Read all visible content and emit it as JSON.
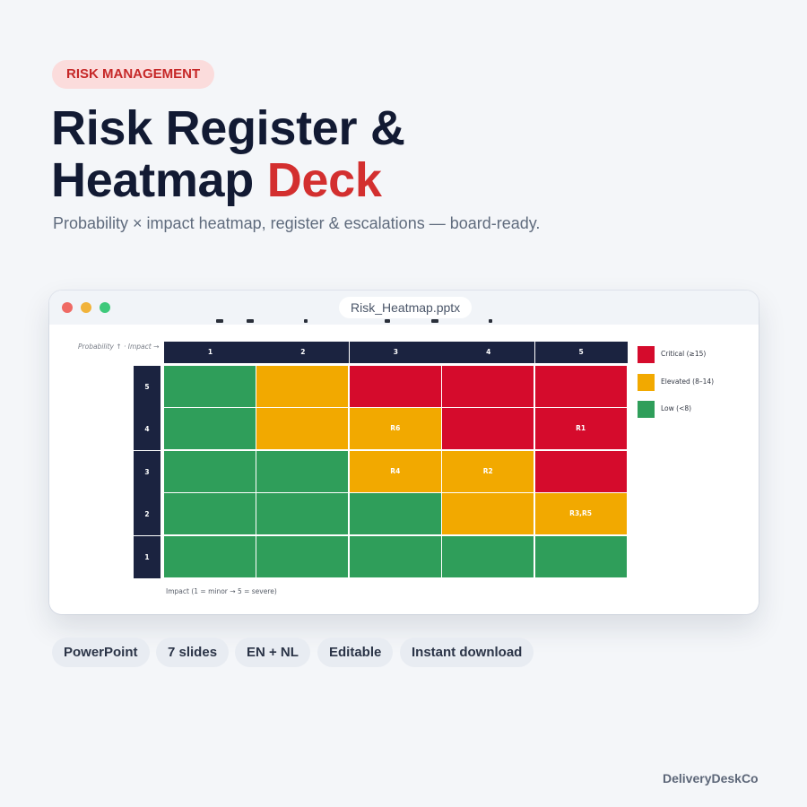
{
  "tag": "RISK MANAGEMENT",
  "title": {
    "line1": "Risk Register &",
    "line2_main": "Heatmap ",
    "line2_accent": "Deck"
  },
  "subtitle": "Probability × impact heatmap, register & escalations — board-ready.",
  "window": {
    "filename": "Risk_Heatmap.pptx"
  },
  "colors": {
    "accent": "#d32f2f",
    "critical": "#d50b2c",
    "elevated": "#f2a900",
    "low": "#2f9e5a",
    "header_navy": "#1b2340"
  },
  "slide": {
    "axis_note": "Probability ↑ · Impact →",
    "foot_note": "Impact (1 = minor → 5 = severe)",
    "column_headers": [
      "1",
      "2",
      "3",
      "4",
      "5"
    ],
    "row_headers": [
      "5",
      "4",
      "3",
      "2",
      "1"
    ],
    "grid": [
      [
        {
          "level": "low",
          "label": ""
        },
        {
          "level": "elevated",
          "label": ""
        },
        {
          "level": "critical",
          "label": ""
        },
        {
          "level": "critical",
          "label": ""
        },
        {
          "level": "critical",
          "label": ""
        }
      ],
      [
        {
          "level": "low",
          "label": ""
        },
        {
          "level": "elevated",
          "label": ""
        },
        {
          "level": "elevated",
          "label": "R6"
        },
        {
          "level": "critical",
          "label": ""
        },
        {
          "level": "critical",
          "label": "R1"
        }
      ],
      [
        {
          "level": "low",
          "label": ""
        },
        {
          "level": "low",
          "label": ""
        },
        {
          "level": "elevated",
          "label": "R4"
        },
        {
          "level": "elevated",
          "label": "R2"
        },
        {
          "level": "critical",
          "label": ""
        }
      ],
      [
        {
          "level": "low",
          "label": ""
        },
        {
          "level": "low",
          "label": ""
        },
        {
          "level": "low",
          "label": ""
        },
        {
          "level": "elevated",
          "label": ""
        },
        {
          "level": "elevated",
          "label": "R3,R5"
        }
      ],
      [
        {
          "level": "low",
          "label": ""
        },
        {
          "level": "low",
          "label": ""
        },
        {
          "level": "low",
          "label": ""
        },
        {
          "level": "low",
          "label": ""
        },
        {
          "level": "low",
          "label": ""
        }
      ]
    ],
    "legend": [
      {
        "level": "critical",
        "label": "Critical (≥15)"
      },
      {
        "level": "elevated",
        "label": "Elevated (8–14)"
      },
      {
        "level": "low",
        "label": "Low (<8)"
      }
    ]
  },
  "badges": [
    "PowerPoint",
    "7 slides",
    "EN + NL",
    "Editable",
    "Instant download"
  ],
  "brand": "DeliveryDeskCo"
}
